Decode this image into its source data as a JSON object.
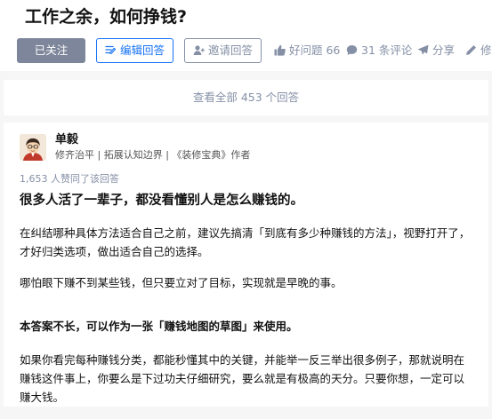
{
  "question": {
    "title": "工作之余，如何挣钱?"
  },
  "actions": {
    "follow_label": "已关注",
    "write_answer_label": "编辑回答",
    "invite_label": "邀请回答",
    "good_question_label": "好问题 66",
    "comments_label": "31 条评论",
    "share_label": "分享",
    "edit_label": "修"
  },
  "view_all": {
    "label": "查看全部 453 个回答"
  },
  "answer": {
    "author": {
      "name": "单毅",
      "bio": "修齐治平 | 拓展认知边界 | 《装修宝典》作者"
    },
    "votes_text": "1,653 人赞同了该回答",
    "headline": "很多人活了一辈子，都没看懂别人是怎么赚钱的。",
    "paragraphs": [
      "在纠结哪种具体方法适合自己之前，建议先搞清「到底有多少种赚钱的方法」，视野打开了，才好归类选项，做出适合自己的选择。",
      "哪怕眼下赚不到某些钱，但只要立对了目标，实现就是早晚的事。",
      "本答案不长，可以作为一张「赚钱地图的草图」来使用。",
      "如果你看完每种赚钱分类，都能秒懂其中的关键，并能举一反三举出很多例子，那就说明在赚钱这件事上，你要么是下过功夫仔细研究，要么就是有极高的天分。只要你想，一定可以赚大钱。"
    ]
  },
  "colors": {
    "accent_blue": "#1772f6",
    "muted_gray": "#8590a6",
    "follow_bg": "#7d869a",
    "page_bg": "#f6f6f6"
  },
  "icons": {
    "write": "edit-list-icon",
    "invite": "person-add-icon",
    "good_question": "thumbs-up-icon",
    "comments": "comment-bubble-icon",
    "share": "paper-plane-icon",
    "edit": "pencil-icon"
  }
}
